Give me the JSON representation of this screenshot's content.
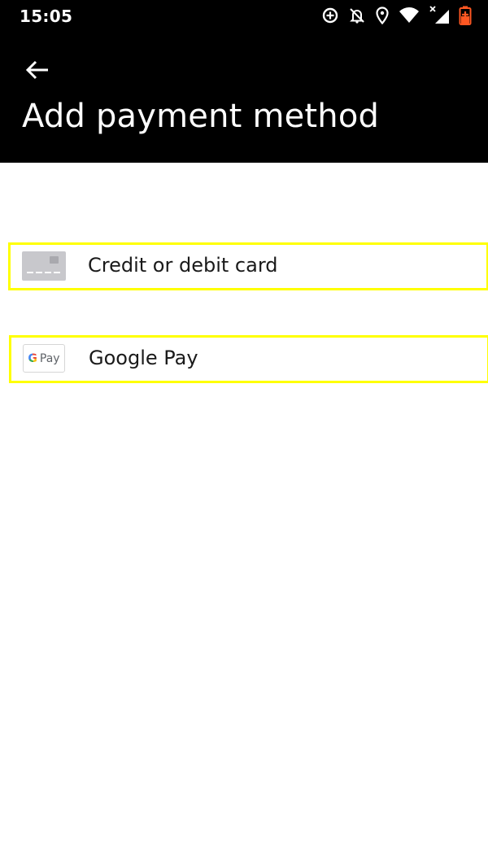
{
  "status_bar": {
    "time": "15:05",
    "icons": [
      "data-saver-icon",
      "notifications-off-icon",
      "location-icon",
      "wifi-icon",
      "signal-icon",
      "battery-icon"
    ]
  },
  "header": {
    "title": "Add payment method",
    "back_icon": "arrow-left-icon"
  },
  "payment_methods": [
    {
      "label": "Credit or debit card",
      "icon": "credit-card-icon"
    },
    {
      "label": "Google Pay",
      "icon": "google-pay-icon",
      "icon_text": "Pay",
      "icon_g": "G"
    }
  ],
  "colors": {
    "header_bg": "#000000",
    "highlight": "#ffff00",
    "card_icon": "#c8c8cc"
  }
}
